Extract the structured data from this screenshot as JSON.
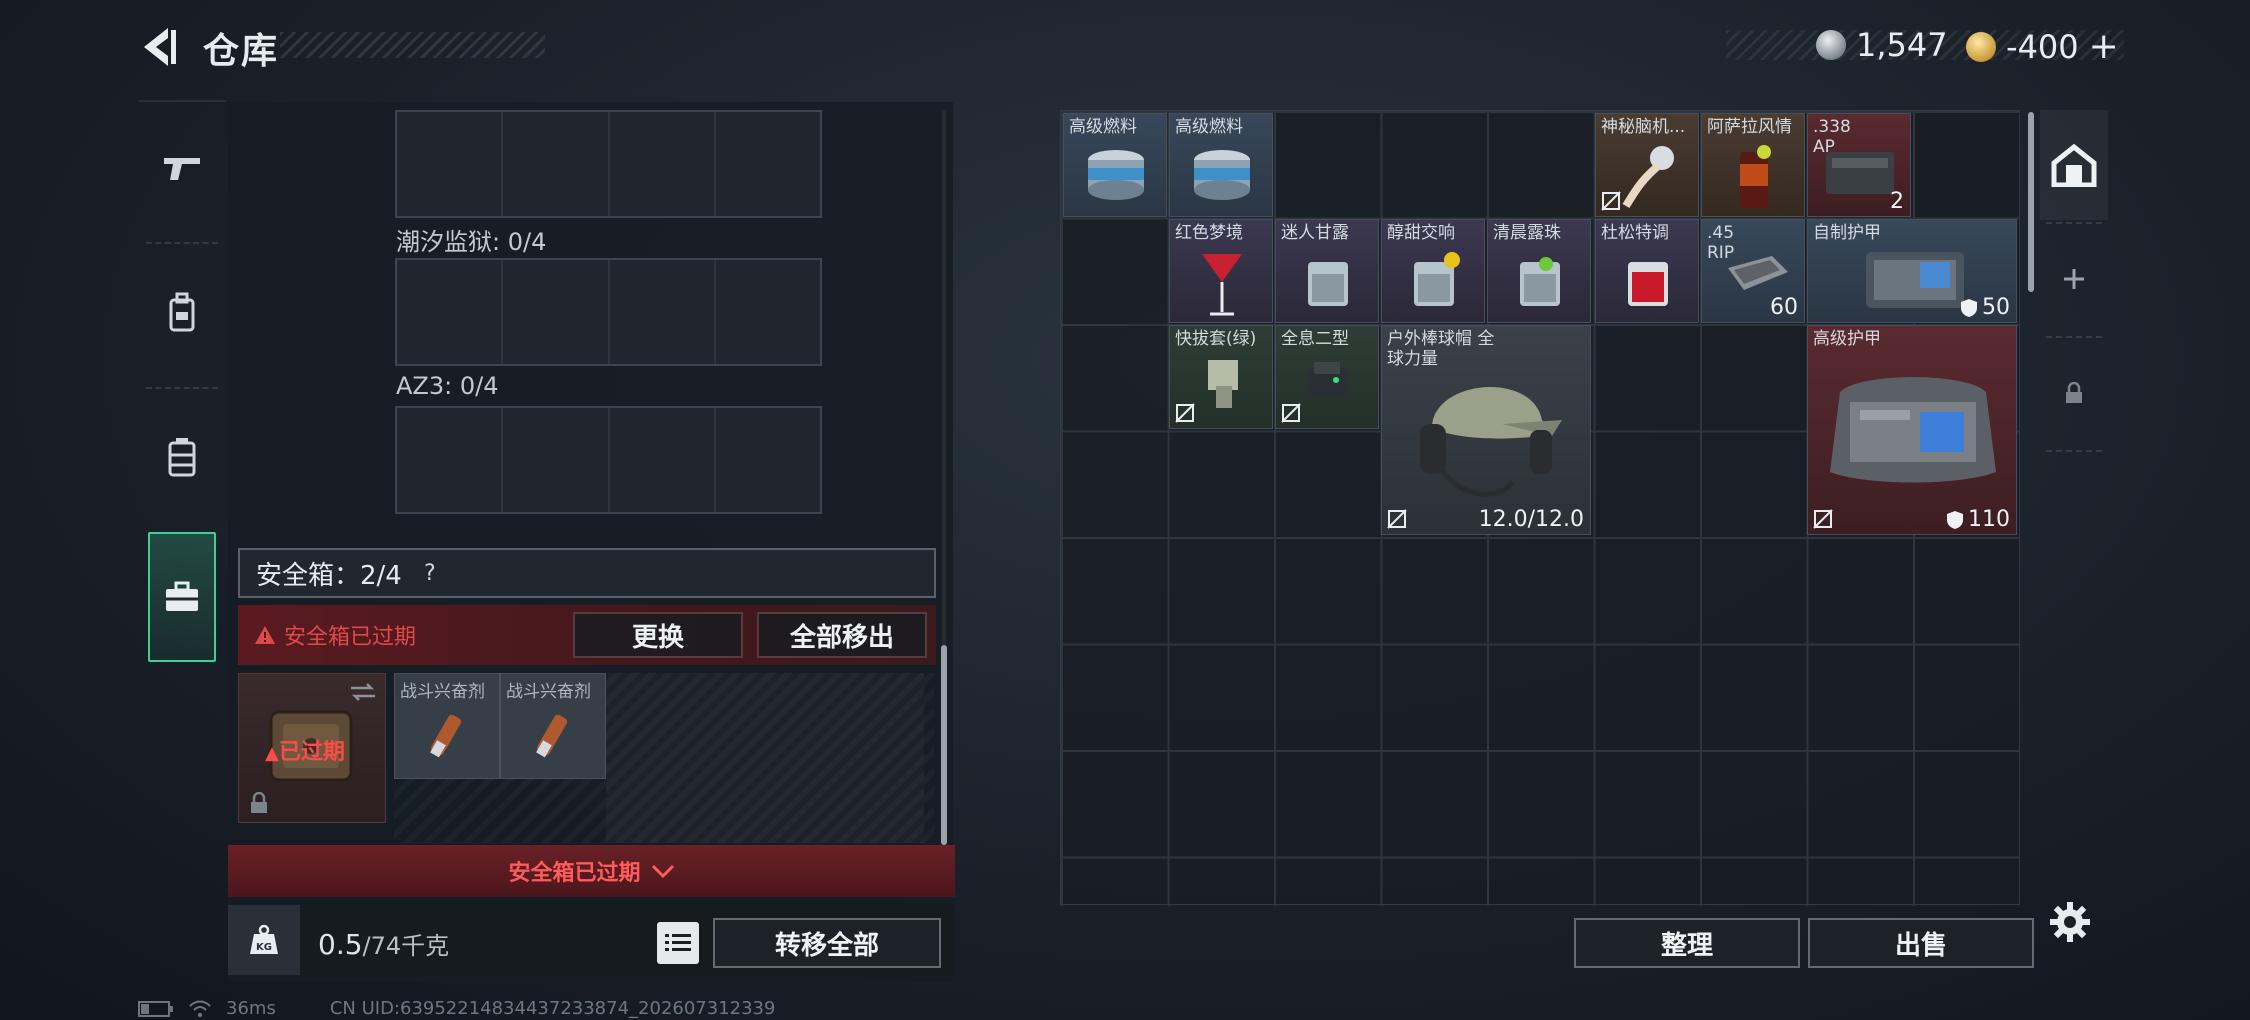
{
  "header": {
    "title": "仓库"
  },
  "currency": {
    "silver": "1,547",
    "gold": "-400",
    "gold_add": "+"
  },
  "left_tabs": [
    {
      "icon": "pistol-icon"
    },
    {
      "icon": "backpack-icon"
    },
    {
      "icon": "rig-icon"
    },
    {
      "icon": "briefcase-icon"
    }
  ],
  "containers": {
    "tide_prison_label": "潮汐监狱: 0/4",
    "az3_label": "AZ3: 0/4"
  },
  "safe_box": {
    "label": "安全箱：2/4",
    "help": "?",
    "expired_warning": "安全箱已过期",
    "replace_button": "更换",
    "remove_all_button": "全部移出",
    "expired_stamp": "已过期",
    "items": [
      "战斗兴奋剂",
      "战斗兴奋剂"
    ],
    "footer": "安全箱已过期"
  },
  "weight": {
    "value": "0.5",
    "unit": "/74千克"
  },
  "transfer_all_button": "转移全部",
  "stash": {
    "items": [
      {
        "name": "高级燃料"
      },
      {
        "name": "高级燃料"
      },
      {
        "name": "神秘脑机..."
      },
      {
        "name": "阿萨拉风情"
      },
      {
        "name": ".338 AP",
        "count": "2"
      },
      {
        "name": "红色梦境"
      },
      {
        "name": "迷人甘露"
      },
      {
        "name": "醇甜交响"
      },
      {
        "name": "清晨露珠"
      },
      {
        "name": "杜松特调"
      },
      {
        "name": ".45 RIP",
        "count": "60"
      },
      {
        "name": "自制护甲",
        "count": "50"
      },
      {
        "name": "快拔套(绿)"
      },
      {
        "name": "全息二型"
      },
      {
        "name": "户外棒球帽 全球力量",
        "count": "12.0/12.0"
      },
      {
        "name": "高级护甲",
        "count": "110"
      }
    ],
    "sort_button": "整理",
    "sell_button": "出售"
  },
  "status_bar": {
    "ping": "36ms",
    "uid": "CN UID:63952214834437233874_202607312339"
  }
}
